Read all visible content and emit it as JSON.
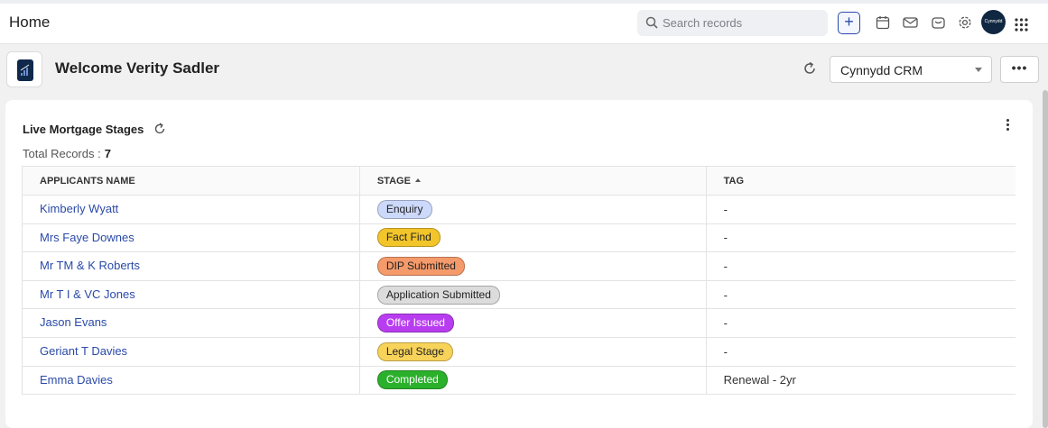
{
  "topbar": {
    "title": "Home",
    "search_placeholder": "Search records",
    "add_label": "+",
    "avatar_text": "Cynnydd"
  },
  "welcome": {
    "title": "Welcome Verity Sadler",
    "crm_selected": "Cynnydd CRM",
    "more_label": "•••"
  },
  "card": {
    "title": "Live Mortgage Stages",
    "total_label": "Total Records :",
    "total_value": "7",
    "columns": [
      "APPLICANTS NAME",
      "STAGE",
      "TAG"
    ],
    "rows": [
      {
        "name": "Kimberly Wyatt",
        "stage": "Enquiry",
        "stage_color": "#cdd9fb",
        "tag": "-"
      },
      {
        "name": "Mrs Faye Downes",
        "stage": "Fact Find",
        "stage_color": "#f2c52b",
        "tag": "-"
      },
      {
        "name": "Mr TM & K Roberts",
        "stage": "DIP Submitted",
        "stage_color": "#f59a6b",
        "tag": "-"
      },
      {
        "name": "Mr T I & VC Jones",
        "stage": "Application Submitted",
        "stage_color": "#dcdcdc",
        "tag": "-"
      },
      {
        "name": "Jason Evans",
        "stage": "Offer Issued",
        "stage_color": "#b93df0",
        "tag": "-"
      },
      {
        "name": "Geriant T Davies",
        "stage": "Legal Stage",
        "stage_color": "#f8d35a",
        "tag": "-"
      },
      {
        "name": "Emma Davies",
        "stage": "Completed",
        "stage_color": "#2bb02b",
        "tag": "Renewal - 2yr"
      }
    ]
  },
  "colors": {
    "accent": "#2a4aa8",
    "link": "#2a4aa8"
  }
}
